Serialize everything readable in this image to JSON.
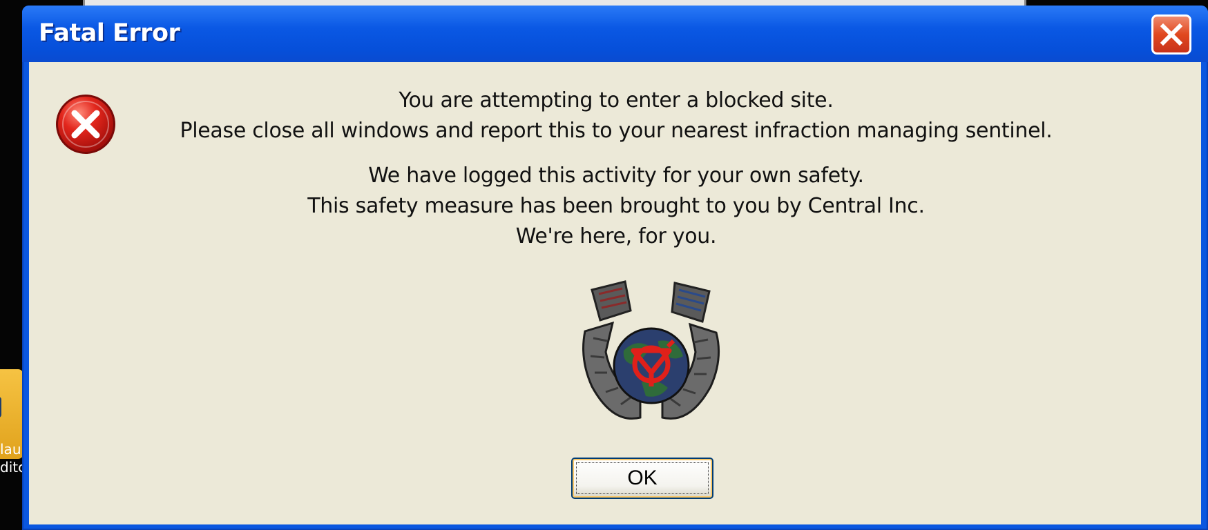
{
  "dialog": {
    "title": "Fatal Error",
    "message_lines": [
      "You are attempting to enter a blocked site.",
      "Please close all windows and report this to your nearest infraction managing sentinel.",
      "We have logged this activity for your own safety.",
      "This safety measure has been brought to you by Central Inc.",
      "We're here, for you."
    ],
    "ok_label": "OK",
    "icons": {
      "error": "error-icon",
      "close": "close-icon",
      "logo": "central-inc-logo"
    },
    "colors": {
      "titlebar": "#0a58e4",
      "client_bg": "#ece9d8",
      "close_red": "#e0481f",
      "error_red": "#d8231b"
    }
  },
  "desktop": {
    "partial_labels": [
      "lau",
      "ditc"
    ]
  }
}
